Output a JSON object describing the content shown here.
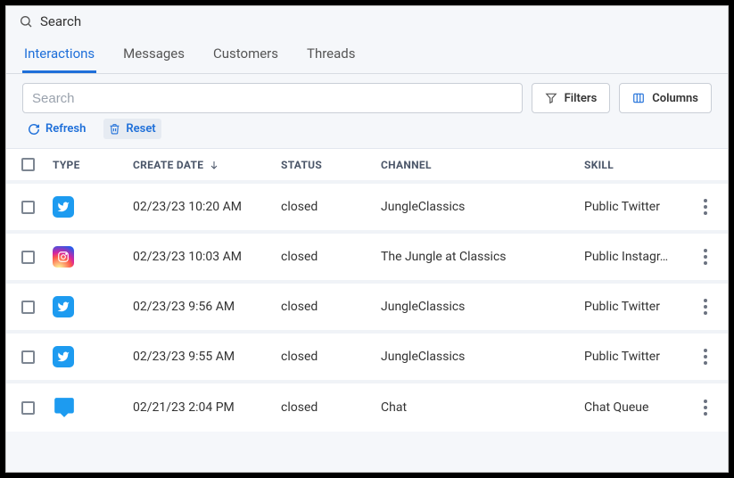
{
  "topbar": {
    "label": "Search"
  },
  "tabs": [
    {
      "label": "Interactions",
      "active": true
    },
    {
      "label": "Messages"
    },
    {
      "label": "Customers"
    },
    {
      "label": "Threads"
    }
  ],
  "controls": {
    "search_placeholder": "Search",
    "filters_label": "Filters",
    "columns_label": "Columns"
  },
  "actions": {
    "refresh_label": "Refresh",
    "reset_label": "Reset"
  },
  "columns": {
    "type": "TYPE",
    "create_date": "CREATE DATE",
    "status": "STATUS",
    "channel": "CHANNEL",
    "skill": "SKILL"
  },
  "rows": [
    {
      "type": "twitter",
      "create_date": "02/23/23 10:20 AM",
      "status": "closed",
      "channel": "JungleClassics",
      "skill": "Public Twitter"
    },
    {
      "type": "instagram",
      "create_date": "02/23/23 10:03 AM",
      "status": "closed",
      "channel": "The Jungle at Classics",
      "skill": "Public Instagr…"
    },
    {
      "type": "twitter",
      "create_date": "02/23/23 9:56 AM",
      "status": "closed",
      "channel": "JungleClassics",
      "skill": "Public Twitter"
    },
    {
      "type": "twitter",
      "create_date": "02/23/23 9:55 AM",
      "status": "closed",
      "channel": "JungleClassics",
      "skill": "Public Twitter"
    },
    {
      "type": "chat",
      "create_date": "02/21/23 2:04 PM",
      "status": "closed",
      "channel": "Chat",
      "skill": "Chat Queue"
    }
  ]
}
